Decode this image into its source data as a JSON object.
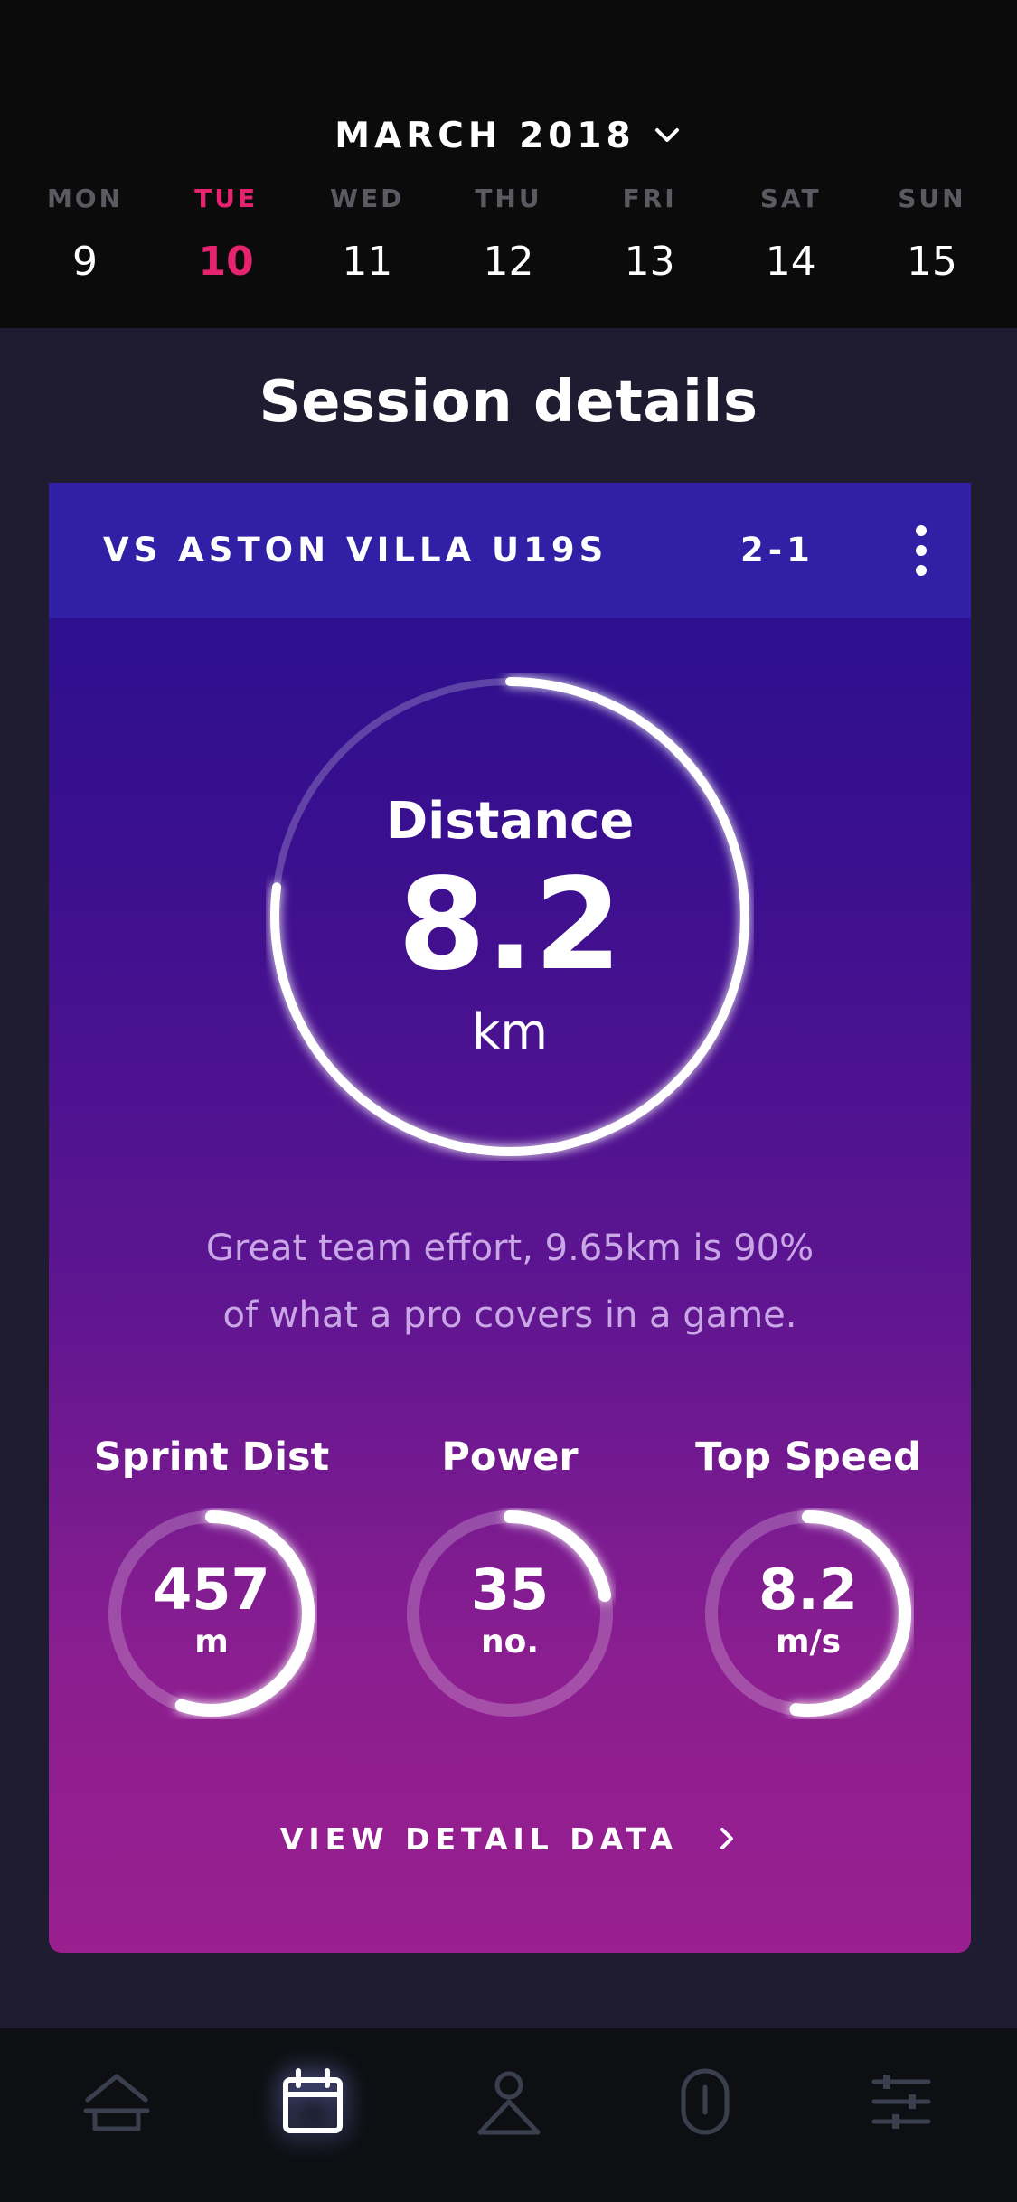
{
  "calendar": {
    "month_label": "MARCH 2018",
    "days": [
      {
        "name": "MON",
        "num": "9"
      },
      {
        "name": "TUE",
        "num": "10"
      },
      {
        "name": "WED",
        "num": "11"
      },
      {
        "name": "THU",
        "num": "12"
      },
      {
        "name": "FRI",
        "num": "13"
      },
      {
        "name": "SAT",
        "num": "14"
      },
      {
        "name": "SUN",
        "num": "15"
      }
    ],
    "selected_day": "TUE"
  },
  "page": {
    "title": "Session details"
  },
  "session": {
    "opponent": "VS ASTON VILLA U19S",
    "score": "2-1",
    "distance": {
      "label": "Distance",
      "value": "8.2",
      "unit": "km",
      "progress": 0.77
    },
    "message_line1": "Great team effort, 9.65km is 90%",
    "message_line2": "of what a pro covers in a game.",
    "stats": [
      {
        "label": "Sprint Dist",
        "value": "457",
        "unit": "m",
        "progress": 0.55
      },
      {
        "label": "Power",
        "value": "35",
        "unit": "no.",
        "progress": 0.22
      },
      {
        "label": "Top Speed",
        "value": "8.2",
        "unit": "m/s",
        "progress": 0.52
      }
    ],
    "view_detail_label": "VIEW DETAIL DATA"
  },
  "nav": {
    "items": [
      {
        "icon": "home-icon",
        "active": false
      },
      {
        "icon": "calendar-icon",
        "active": true
      },
      {
        "icon": "profile-icon",
        "active": false
      },
      {
        "icon": "device-icon",
        "active": false
      },
      {
        "icon": "settings-sliders-icon",
        "active": false
      }
    ]
  },
  "colors": {
    "accent": "#e5236f",
    "header_bg": "#0b0b0c",
    "card_head": "#3120a6",
    "card_gradient_top": "#25108d",
    "card_gradient_bottom": "#9a1f8f",
    "message_text": "#c9a6e6"
  }
}
